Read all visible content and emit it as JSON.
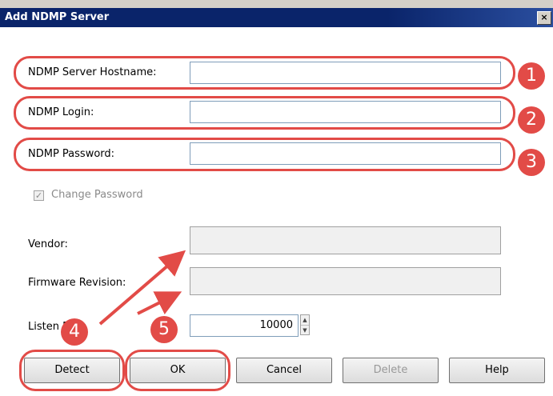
{
  "window": {
    "title": "Add NDMP Server",
    "close_glyph": "×"
  },
  "fields": {
    "hostname": {
      "label": "NDMP Server Hostname:",
      "value": ""
    },
    "login": {
      "label": "NDMP Login:",
      "value": ""
    },
    "password": {
      "label": "NDMP Password:",
      "value": ""
    },
    "change_password": {
      "label": "Change Password",
      "checked": true,
      "check_glyph": "✓"
    },
    "vendor": {
      "label": "Vendor:",
      "value": ""
    },
    "firmware": {
      "label": "Firmware Revision:",
      "value": ""
    },
    "listen_port": {
      "label": "Listen Port:",
      "value": "10000"
    }
  },
  "buttons": {
    "detect": "Detect",
    "ok": "OK",
    "cancel": "Cancel",
    "delete": "Delete",
    "help": "Help"
  },
  "annotations": {
    "colors": {
      "accent": "#e24b47"
    },
    "badges": [
      "1",
      "2",
      "3",
      "4",
      "5"
    ]
  }
}
